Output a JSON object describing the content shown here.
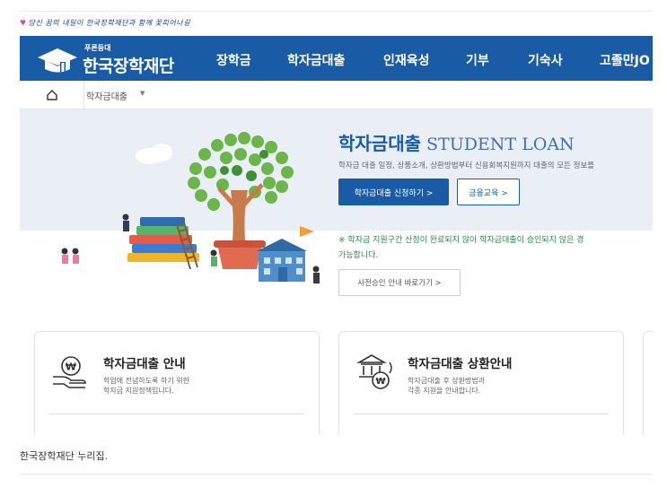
{
  "header": {
    "slogan": "당신 꿈의 내일이 한국장학재단과 함께 꽃피어나길",
    "logo_small": "푸른등대",
    "logo_main": "한국장학재단"
  },
  "nav": {
    "items": [
      "장학금",
      "학자금대출",
      "인재육성",
      "기부",
      "기숙사",
      "고졸만JO"
    ]
  },
  "breadcrumb": {
    "current": "학자금대출",
    "caret": "▼"
  },
  "hero": {
    "title_ko": "학자금대출",
    "title_en": "STUDENT LOAN",
    "description": "학자금 대출 일정, 상품소개, 상환방법부터 신용회복지원까지 대출의 모든 정보를",
    "apply_button": "학자금대출 신청하기 >",
    "edu_button": "금융교육 >",
    "notice_line1": "※ 학자금 지원구간 산정이 완료되지 않아 학자금대출이 승인되지 않은 경",
    "notice_line2": "가능합니다.",
    "pre_approval_button": "사전승인 안내 바로가기 >"
  },
  "cards": [
    {
      "title": "학자금대출 안내",
      "desc_line1": "학업에 전념하도록 하기 위한",
      "desc_line2": "학자금 지원정책입니다.",
      "icon": "won-hand-icon"
    },
    {
      "title": "학자금대출 상환안내",
      "desc_line1": "학자금대출 후 상환방법과",
      "desc_line2": "각종 지원을 안내합니다.",
      "icon": "bank-won-icon"
    }
  ],
  "caption": "한국장학재단 누리집.",
  "colors": {
    "brand_blue": "#1a5ba6",
    "notice_green": "#2a8a4a",
    "hero_band": "#eaeef5"
  }
}
